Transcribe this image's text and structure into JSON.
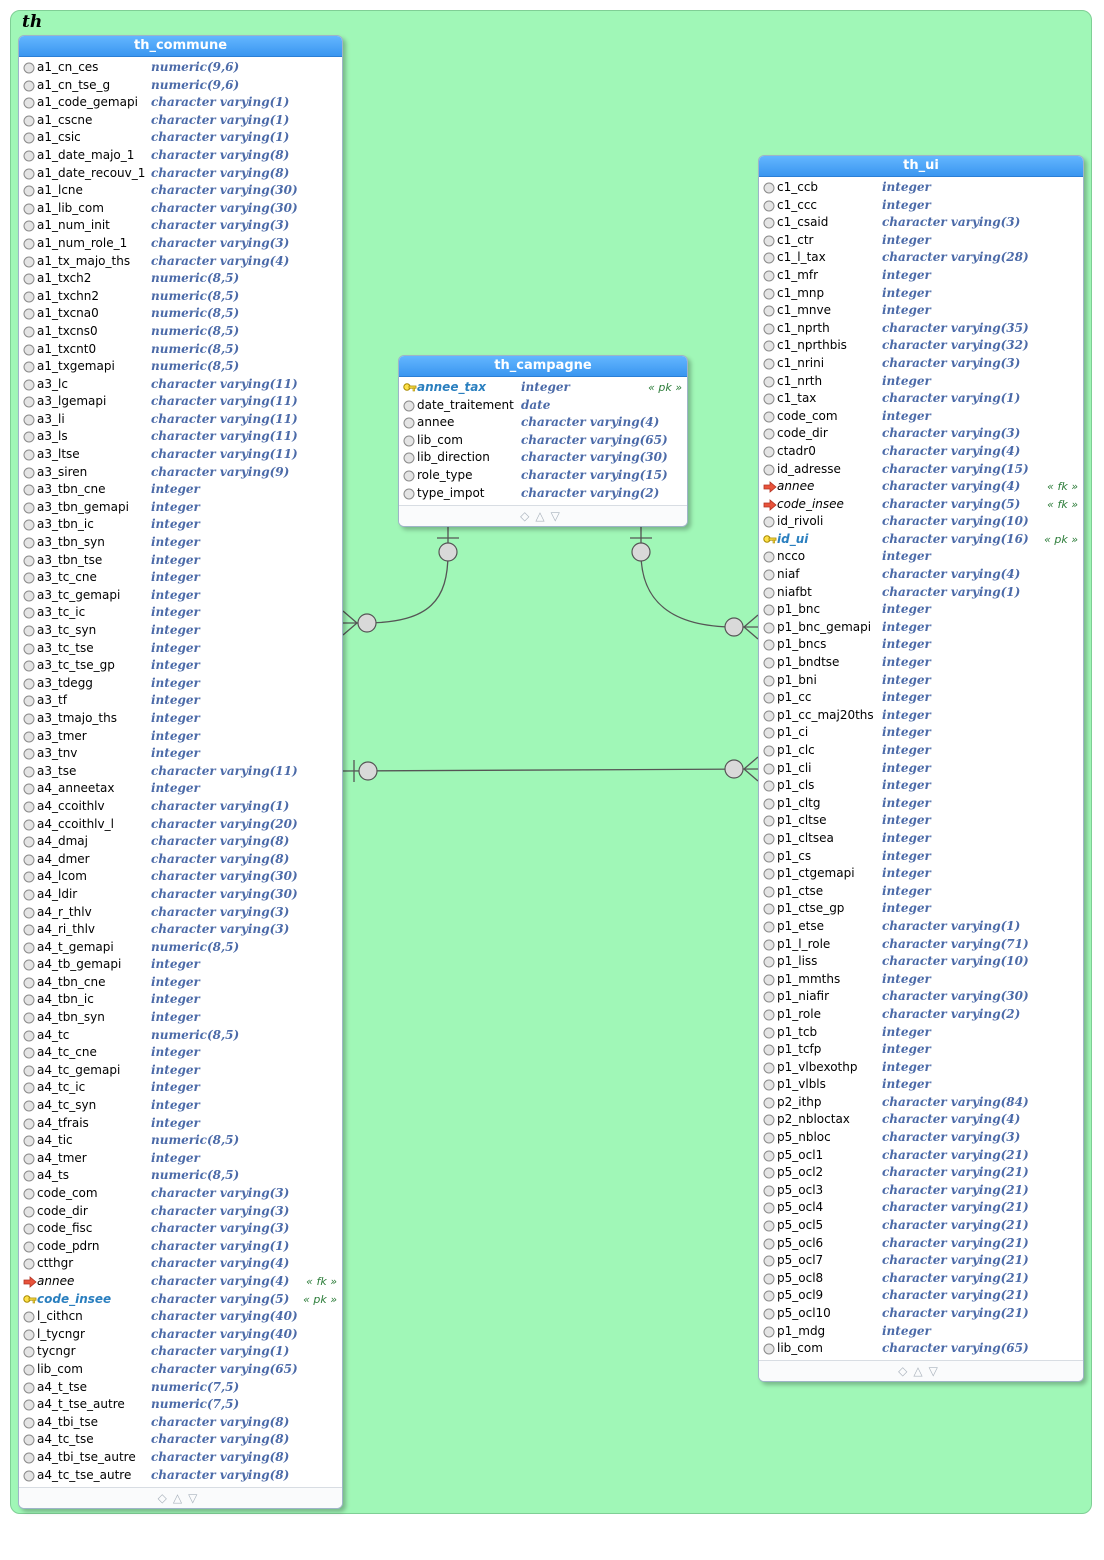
{
  "schema": {
    "name": "th"
  },
  "tables": {
    "th_commune": {
      "title": "th_commune",
      "columns": [
        {
          "name": "a1_cn_ces",
          "type": "numeric(9,6)"
        },
        {
          "name": "a1_cn_tse_g",
          "type": "numeric(9,6)"
        },
        {
          "name": "a1_code_gemapi",
          "type": "character varying(1)"
        },
        {
          "name": "a1_cscne",
          "type": "character varying(1)"
        },
        {
          "name": "a1_csic",
          "type": "character varying(1)"
        },
        {
          "name": "a1_date_majo_1",
          "type": "character varying(8)"
        },
        {
          "name": "a1_date_recouv_1",
          "type": "character varying(8)"
        },
        {
          "name": "a1_lcne",
          "type": "character varying(30)"
        },
        {
          "name": "a1_lib_com",
          "type": "character varying(30)"
        },
        {
          "name": "a1_num_init",
          "type": "character varying(3)"
        },
        {
          "name": "a1_num_role_1",
          "type": "character varying(3)"
        },
        {
          "name": "a1_tx_majo_ths",
          "type": "character varying(4)"
        },
        {
          "name": "a1_txch2",
          "type": "numeric(8,5)"
        },
        {
          "name": "a1_txchn2",
          "type": "numeric(8,5)"
        },
        {
          "name": "a1_txcna0",
          "type": "numeric(8,5)"
        },
        {
          "name": "a1_txcns0",
          "type": "numeric(8,5)"
        },
        {
          "name": "a1_txcnt0",
          "type": "numeric(8,5)"
        },
        {
          "name": "a1_txgemapi",
          "type": "numeric(8,5)"
        },
        {
          "name": "a3_lc",
          "type": "character varying(11)"
        },
        {
          "name": "a3_lgemapi",
          "type": "character varying(11)"
        },
        {
          "name": "a3_li",
          "type": "character varying(11)"
        },
        {
          "name": "a3_ls",
          "type": "character varying(11)"
        },
        {
          "name": "a3_ltse",
          "type": "character varying(11)"
        },
        {
          "name": "a3_siren",
          "type": "character varying(9)"
        },
        {
          "name": "a3_tbn_cne",
          "type": "integer"
        },
        {
          "name": "a3_tbn_gemapi",
          "type": "integer"
        },
        {
          "name": "a3_tbn_ic",
          "type": "integer"
        },
        {
          "name": "a3_tbn_syn",
          "type": "integer"
        },
        {
          "name": "a3_tbn_tse",
          "type": "integer"
        },
        {
          "name": "a3_tc_cne",
          "type": "integer"
        },
        {
          "name": "a3_tc_gemapi",
          "type": "integer"
        },
        {
          "name": "a3_tc_ic",
          "type": "integer"
        },
        {
          "name": "a3_tc_syn",
          "type": "integer"
        },
        {
          "name": "a3_tc_tse",
          "type": "integer"
        },
        {
          "name": "a3_tc_tse_gp",
          "type": "integer"
        },
        {
          "name": "a3_tdegg",
          "type": "integer"
        },
        {
          "name": "a3_tf",
          "type": "integer"
        },
        {
          "name": "a3_tmajo_ths",
          "type": "integer"
        },
        {
          "name": "a3_tmer",
          "type": "integer"
        },
        {
          "name": "a3_tnv",
          "type": "integer"
        },
        {
          "name": "a3_tse",
          "type": "character varying(11)"
        },
        {
          "name": "a4_anneetax",
          "type": "integer"
        },
        {
          "name": "a4_ccoithlv",
          "type": "character varying(1)"
        },
        {
          "name": "a4_ccoithlv_l",
          "type": "character varying(20)"
        },
        {
          "name": "a4_dmaj",
          "type": "character varying(8)"
        },
        {
          "name": "a4_dmer",
          "type": "character varying(8)"
        },
        {
          "name": "a4_lcom",
          "type": "character varying(30)"
        },
        {
          "name": "a4_ldir",
          "type": "character varying(30)"
        },
        {
          "name": "a4_r_thlv",
          "type": "character varying(3)"
        },
        {
          "name": "a4_ri_thlv",
          "type": "character varying(3)"
        },
        {
          "name": "a4_t_gemapi",
          "type": "numeric(8,5)"
        },
        {
          "name": "a4_tb_gemapi",
          "type": "integer"
        },
        {
          "name": "a4_tbn_cne",
          "type": "integer"
        },
        {
          "name": "a4_tbn_ic",
          "type": "integer"
        },
        {
          "name": "a4_tbn_syn",
          "type": "integer"
        },
        {
          "name": "a4_tc",
          "type": "numeric(8,5)"
        },
        {
          "name": "a4_tc_cne",
          "type": "integer"
        },
        {
          "name": "a4_tc_gemapi",
          "type": "integer"
        },
        {
          "name": "a4_tc_ic",
          "type": "integer"
        },
        {
          "name": "a4_tc_syn",
          "type": "integer"
        },
        {
          "name": "a4_tfrais",
          "type": "integer"
        },
        {
          "name": "a4_tic",
          "type": "numeric(8,5)"
        },
        {
          "name": "a4_tmer",
          "type": "integer"
        },
        {
          "name": "a4_ts",
          "type": "numeric(8,5)"
        },
        {
          "name": "code_com",
          "type": "character varying(3)"
        },
        {
          "name": "code_dir",
          "type": "character varying(3)"
        },
        {
          "name": "code_fisc",
          "type": "character varying(3)"
        },
        {
          "name": "code_pdrn",
          "type": "character varying(1)"
        },
        {
          "name": "ctthgr",
          "type": "character varying(4)"
        },
        {
          "name": "annee",
          "type": "character varying(4)",
          "key": "fk",
          "tag": "« fk »"
        },
        {
          "name": "code_insee",
          "type": "character varying(5)",
          "key": "pk",
          "tag": "« pk »"
        },
        {
          "name": "l_cithcn",
          "type": "character varying(40)"
        },
        {
          "name": "l_tycngr",
          "type": "character varying(40)"
        },
        {
          "name": "tycngr",
          "type": "character varying(1)"
        },
        {
          "name": "lib_com",
          "type": "character varying(65)"
        },
        {
          "name": "a4_t_tse",
          "type": "numeric(7,5)"
        },
        {
          "name": "a4_t_tse_autre",
          "type": "numeric(7,5)"
        },
        {
          "name": "a4_tbi_tse",
          "type": "character varying(8)"
        },
        {
          "name": "a4_tc_tse",
          "type": "character varying(8)"
        },
        {
          "name": "a4_tbi_tse_autre",
          "type": "character varying(8)"
        },
        {
          "name": "a4_tc_tse_autre",
          "type": "character varying(8)"
        }
      ]
    },
    "th_campagne": {
      "title": "th_campagne",
      "columns": [
        {
          "name": "annee_tax",
          "type": "integer",
          "key": "pk",
          "tag": "« pk »"
        },
        {
          "name": "date_traitement",
          "type": "date"
        },
        {
          "name": "annee",
          "type": "character varying(4)"
        },
        {
          "name": "lib_com",
          "type": "character varying(65)"
        },
        {
          "name": "lib_direction",
          "type": "character varying(30)"
        },
        {
          "name": "role_type",
          "type": "character varying(15)"
        },
        {
          "name": "type_impot",
          "type": "character varying(2)"
        }
      ]
    },
    "th_ui": {
      "title": "th_ui",
      "columns": [
        {
          "name": "c1_ccb",
          "type": "integer"
        },
        {
          "name": "c1_ccc",
          "type": "integer"
        },
        {
          "name": "c1_csaid",
          "type": "character varying(3)"
        },
        {
          "name": "c1_ctr",
          "type": "integer"
        },
        {
          "name": "c1_l_tax",
          "type": "character varying(28)"
        },
        {
          "name": "c1_mfr",
          "type": "integer"
        },
        {
          "name": "c1_mnp",
          "type": "integer"
        },
        {
          "name": "c1_mnve",
          "type": "integer"
        },
        {
          "name": "c1_nprth",
          "type": "character varying(35)"
        },
        {
          "name": "c1_nprthbis",
          "type": "character varying(32)"
        },
        {
          "name": "c1_nrini",
          "type": "character varying(3)"
        },
        {
          "name": "c1_nrth",
          "type": "integer"
        },
        {
          "name": "c1_tax",
          "type": "character varying(1)"
        },
        {
          "name": "code_com",
          "type": "integer"
        },
        {
          "name": "code_dir",
          "type": "character varying(3)"
        },
        {
          "name": "ctadr0",
          "type": "character varying(4)"
        },
        {
          "name": "id_adresse",
          "type": "character varying(15)"
        },
        {
          "name": "annee",
          "type": "character varying(4)",
          "key": "fk",
          "tag": "« fk »"
        },
        {
          "name": "code_insee",
          "type": "character varying(5)",
          "key": "fk",
          "tag": "« fk »"
        },
        {
          "name": "id_rivoli",
          "type": "character varying(10)"
        },
        {
          "name": "id_ui",
          "type": "character varying(16)",
          "key": "pk",
          "tag": "« pk »"
        },
        {
          "name": "ncco",
          "type": "integer"
        },
        {
          "name": "niaf",
          "type": "character varying(4)"
        },
        {
          "name": "niafbt",
          "type": "character varying(1)"
        },
        {
          "name": "p1_bnc",
          "type": "integer"
        },
        {
          "name": "p1_bnc_gemapi",
          "type": "integer"
        },
        {
          "name": "p1_bncs",
          "type": "integer"
        },
        {
          "name": "p1_bndtse",
          "type": "integer"
        },
        {
          "name": "p1_bni",
          "type": "integer"
        },
        {
          "name": "p1_cc",
          "type": "integer"
        },
        {
          "name": "p1_cc_maj20ths",
          "type": "integer"
        },
        {
          "name": "p1_ci",
          "type": "integer"
        },
        {
          "name": "p1_clc",
          "type": "integer"
        },
        {
          "name": "p1_cli",
          "type": "integer"
        },
        {
          "name": "p1_cls",
          "type": "integer"
        },
        {
          "name": "p1_cltg",
          "type": "integer"
        },
        {
          "name": "p1_cltse",
          "type": "integer"
        },
        {
          "name": "p1_cltsea",
          "type": "integer"
        },
        {
          "name": "p1_cs",
          "type": "integer"
        },
        {
          "name": "p1_ctgemapi",
          "type": "integer"
        },
        {
          "name": "p1_ctse",
          "type": "integer"
        },
        {
          "name": "p1_ctse_gp",
          "type": "integer"
        },
        {
          "name": "p1_etse",
          "type": "character varying(1)"
        },
        {
          "name": "p1_l_role",
          "type": "character varying(71)"
        },
        {
          "name": "p1_liss",
          "type": "character varying(10)"
        },
        {
          "name": "p1_mmths",
          "type": "integer"
        },
        {
          "name": "p1_niafir",
          "type": "character varying(30)"
        },
        {
          "name": "p1_role",
          "type": "character varying(2)"
        },
        {
          "name": "p1_tcb",
          "type": "integer"
        },
        {
          "name": "p1_tcfp",
          "type": "integer"
        },
        {
          "name": "p1_vlbexothp",
          "type": "integer"
        },
        {
          "name": "p1_vlbls",
          "type": "integer"
        },
        {
          "name": "p2_ithp",
          "type": "character varying(84)"
        },
        {
          "name": "p2_nbloctax",
          "type": "character varying(4)"
        },
        {
          "name": "p5_nbloc",
          "type": "character varying(3)"
        },
        {
          "name": "p5_ocl1",
          "type": "character varying(21)"
        },
        {
          "name": "p5_ocl2",
          "type": "character varying(21)"
        },
        {
          "name": "p5_ocl3",
          "type": "character varying(21)"
        },
        {
          "name": "p5_ocl4",
          "type": "character varying(21)"
        },
        {
          "name": "p5_ocl5",
          "type": "character varying(21)"
        },
        {
          "name": "p5_ocl6",
          "type": "character varying(21)"
        },
        {
          "name": "p5_ocl7",
          "type": "character varying(21)"
        },
        {
          "name": "p5_ocl8",
          "type": "character varying(21)"
        },
        {
          "name": "p5_ocl9",
          "type": "character varying(21)"
        },
        {
          "name": "p5_ocl10",
          "type": "character varying(21)"
        },
        {
          "name": "p1_mdg",
          "type": "integer"
        },
        {
          "name": "lib_com",
          "type": "character varying(65)"
        }
      ]
    }
  },
  "footer_icons": [
    "diamond-icon",
    "triangle-up-icon",
    "triangle-down-icon"
  ],
  "colors": {
    "background": "#a0f7b7",
    "header": "#3a96f0",
    "type_text": "#4b6aa8",
    "pk": "#2a7fbf",
    "fk_arrow": "#e8533b"
  }
}
